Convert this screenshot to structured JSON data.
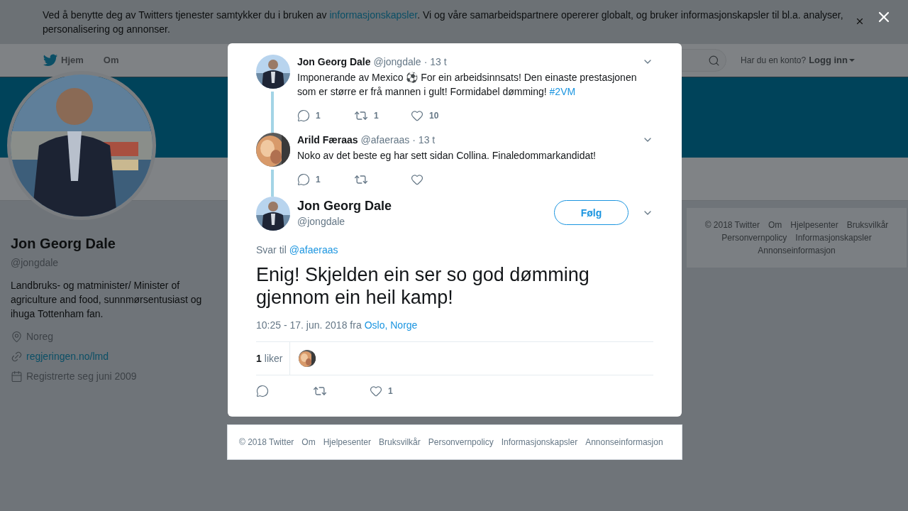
{
  "cookie_banner": {
    "text_before": "Ved å benytte deg av Twitters tjenester samtykker du i bruken av ",
    "link": "informasjonskapsler",
    "text_after": ". Vi og våre samarbeidspartnere opererer globalt, og bruker informasjonskapsler til bl.a. analyser, personalisering og annonser."
  },
  "nav": {
    "items": [
      {
        "label": "Hjem",
        "kind": "home"
      },
      {
        "label": "Om",
        "kind": "plain"
      }
    ],
    "login_prompt": "Har du en konto?",
    "login_link": "Logg inn"
  },
  "profile": {
    "name": "Jon Georg Dale",
    "handle": "@jongdale",
    "bio": "Landbruks- og matminister/ Minister of agriculture and food, sunnmørsentusiast og ihuga Tottenham fan.",
    "details": [
      {
        "kind": "location",
        "text": "Noreg"
      },
      {
        "kind": "link",
        "text": "regjeringen.no/lmd"
      },
      {
        "kind": "joined",
        "text": "Registrerte seg juni 2009"
      }
    ]
  },
  "side_footer": [
    "© 2018 Twitter",
    "Om",
    "Hjelpesenter",
    "Bruksvilkår",
    "Personvernpolicy",
    "Informasjonskapsler",
    "Annonseinformasjon"
  ],
  "modal": {
    "thread": [
      {
        "name": "Jon Georg Dale",
        "handle": "@jongdale",
        "time": "· 13 t",
        "text": "Imponerande av Mexico ⚽ For ein arbeidsinnsats! Den einaste prestasjonen som er større er frå mannen i gult! Formidabel dømming! ",
        "hashtag": "#2VM",
        "actions": [
          {
            "kind": "reply",
            "count": "1"
          },
          {
            "kind": "retweet",
            "count": "1"
          },
          {
            "kind": "like",
            "count": "10"
          }
        ]
      },
      {
        "name": "Arild Færaas",
        "handle": "@afaeraas",
        "time": "· 13 t",
        "text": "Noko av det beste eg har sett sidan Collina. Finaledommarkandidat!",
        "actions": [
          {
            "kind": "reply",
            "count": "1"
          },
          {
            "kind": "retweet"
          },
          {
            "kind": "like"
          }
        ]
      }
    ],
    "main": {
      "name": "Jon Georg Dale",
      "handle": "@jongdale",
      "follow": "Følg",
      "reply_prefix": "Svar til",
      "reply_link": "@afaeraas",
      "text": "Enig! Skjelden ein ser so god dømming gjennom ein heil kamp!",
      "time": "10:25 - 17. jun. 2018 fra",
      "place": "Oslo, Norge",
      "likes_count": "1",
      "likes_label": "liker",
      "actions": [
        {
          "kind": "reply"
        },
        {
          "kind": "retweet"
        },
        {
          "kind": "like",
          "count": "1"
        }
      ]
    }
  },
  "modal_footer": [
    "© 2018 Twitter",
    "Om",
    "Hjelpesenter",
    "Bruksvilkår",
    "Personvernpolicy",
    "Informasjonskapsler",
    "Annonseinformasjon"
  ]
}
